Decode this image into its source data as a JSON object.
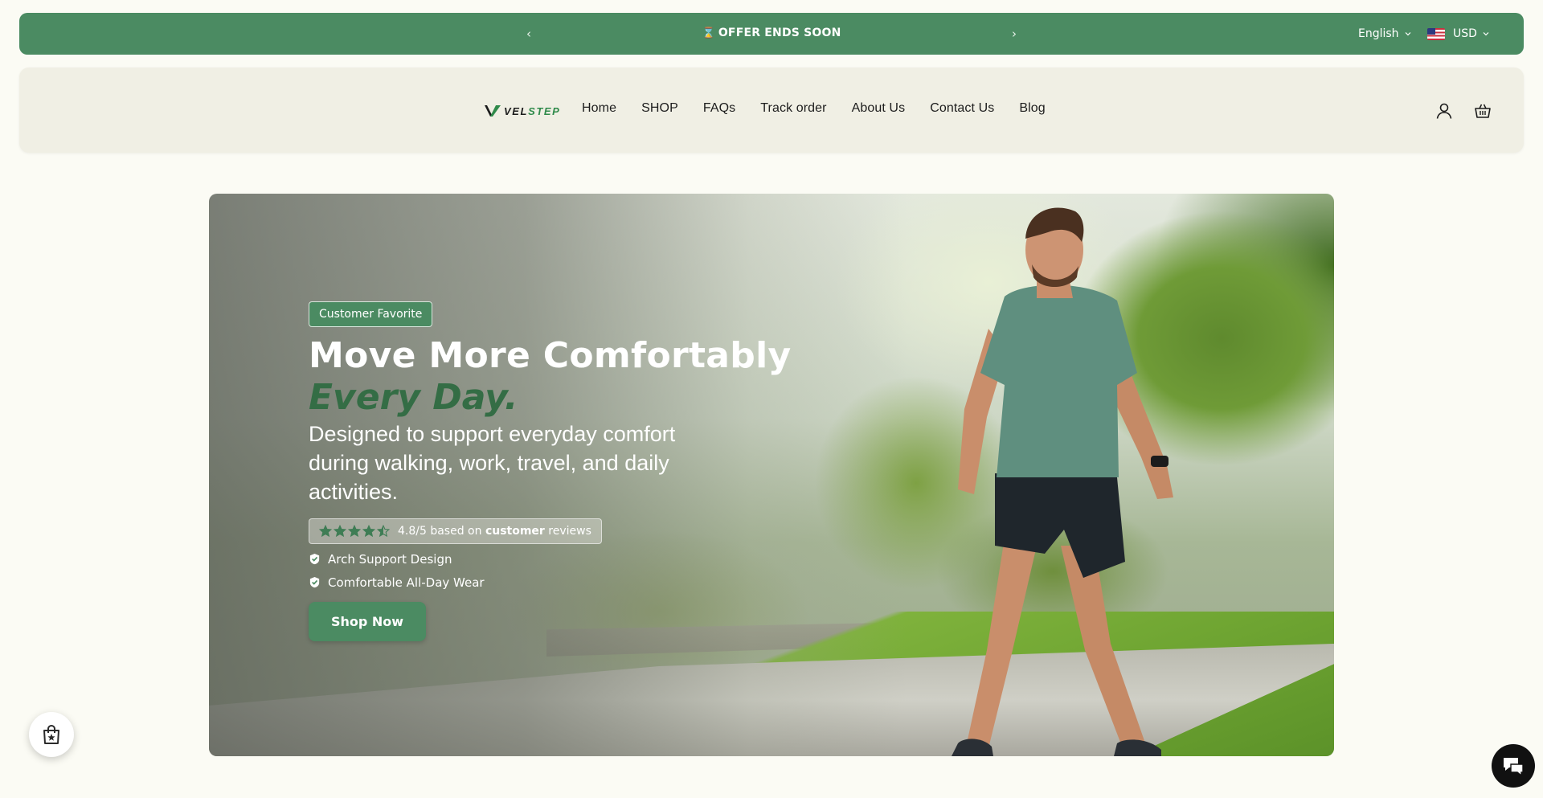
{
  "announcement": {
    "icon": "hourglass-icon",
    "hourglass_glyph": "⌛",
    "text": "OFFER ENDS SOON",
    "prev_glyph": "‹",
    "next_glyph": "›",
    "language": "English",
    "currency": "USD",
    "background": "#4b8b62"
  },
  "header": {
    "logo": {
      "part1": "VEL",
      "part2": "STEP"
    },
    "nav": [
      "Home",
      "SHOP",
      "FAQs",
      "Track order",
      "About Us",
      "Contact Us",
      "Blog"
    ],
    "icons": [
      "user-icon",
      "cart-icon"
    ]
  },
  "hero": {
    "badge": "Customer Favorite",
    "headline": "Move More Comfortably",
    "headline_accent": "Every Day.",
    "subheadline": "Designed to support everyday comfort during walking, work, travel, and daily activities.",
    "rating": {
      "stars": 4.5,
      "prefix": "4.8/5 based on ",
      "emphasis": "customer",
      "suffix": " reviews"
    },
    "features": [
      "Arch Support Design",
      "Comfortable All-Day Wear"
    ],
    "cta": "Shop Now"
  },
  "widgets": {
    "left_icon": "shopping-bag-icon",
    "right_icon": "chat-icon"
  },
  "colors": {
    "accent": "#4b8b62",
    "accent_dark": "#346d45",
    "page_bg": "#fbfbf4",
    "header_bg": "#f0efe4"
  }
}
